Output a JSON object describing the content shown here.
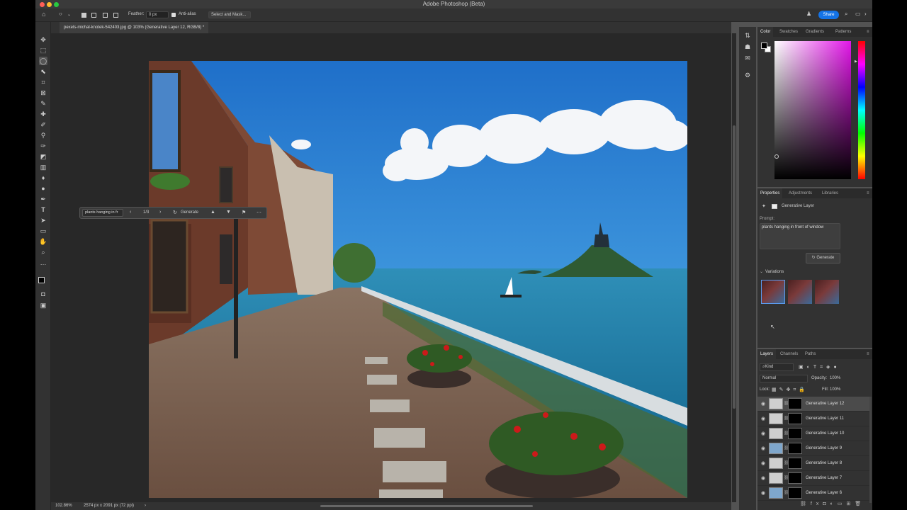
{
  "app": {
    "title": "Adobe Photoshop (Beta)"
  },
  "options": {
    "feather_label": "Feather:",
    "feather_value": "0 px",
    "antialias_label": "Anti-alias",
    "select_mask_label": "Select and Mask..."
  },
  "header": {
    "share_label": "Share"
  },
  "document": {
    "tab_title": "pexels-michal-knotek-542403.jpg @ 103% (Generative Layer 12, RGB/8) *"
  },
  "contextbar": {
    "prompt": "plants hanging in fr",
    "count": "1/3",
    "generate_label": "Generate"
  },
  "status": {
    "zoom": "102.86%",
    "dims": "2574 px x 2091 px (72 ppi)",
    "arrow": "›"
  },
  "color_panel": {
    "tabs": [
      "Color",
      "Swatches",
      "Gradients",
      "Patterns"
    ]
  },
  "properties_panel": {
    "tabs": [
      "Properties",
      "Adjustments",
      "Libraries"
    ],
    "layer_type": "Generative Layer",
    "prompt_label": "Prompt:",
    "prompt_value": "plants hanging in front of window",
    "generate_label": "Generate",
    "variations_label": "Variations"
  },
  "layers_panel": {
    "tabs": [
      "Layers",
      "Channels",
      "Paths"
    ],
    "kind_label": "Kind",
    "blend_mode": "Normal",
    "opacity_label": "Opacity:",
    "opacity_value": "100%",
    "lock_label": "Lock:",
    "fill_label": "Fill:",
    "fill_value": "100%",
    "layers": [
      {
        "name": "Generative Layer 12"
      },
      {
        "name": "Generative Layer 11"
      },
      {
        "name": "Generative Layer 10"
      },
      {
        "name": "Generative Layer 9"
      },
      {
        "name": "Generative Layer 8"
      },
      {
        "name": "Generative Layer 7"
      },
      {
        "name": "Generative Layer 6"
      }
    ]
  },
  "colors": {
    "accent": "#1473e6",
    "panel": "#323232",
    "canvas_bg": "#282828",
    "selected_row": "#4b4b4b"
  }
}
